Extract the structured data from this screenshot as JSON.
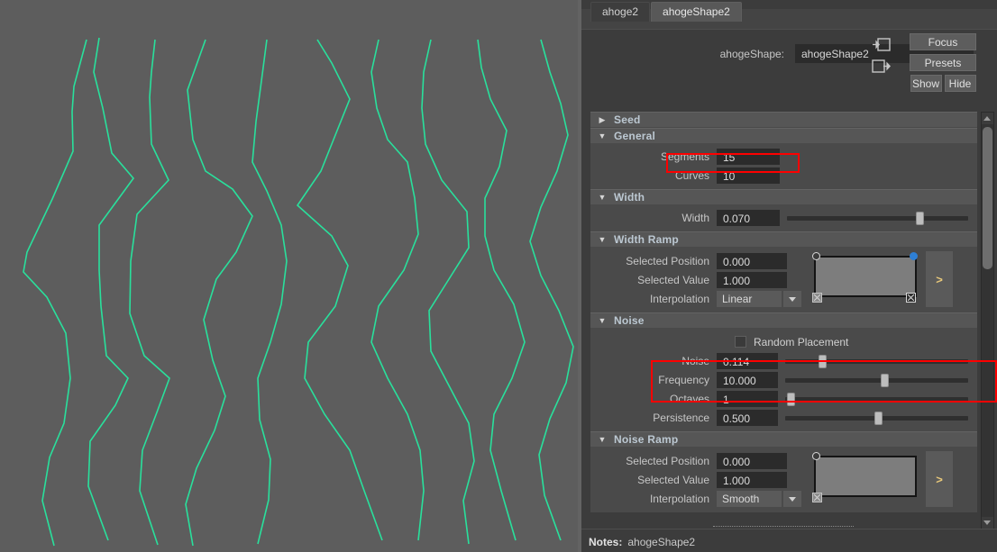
{
  "app": {
    "viewport_bg": "#5d5d5d",
    "curve_color": "#29e09c",
    "panel_bg": "#3c3c3c",
    "highlight_color": "#fe0000"
  },
  "tabs": [
    {
      "label": "ahoge2",
      "active": false
    },
    {
      "label": "ahogeShape2",
      "active": true
    }
  ],
  "name_row": {
    "label": "ahogeShape:",
    "value": "ahogeShape2",
    "placeholder": "ahogeShape2",
    "icon_load": "load-attributes-icon",
    "icon_copy": "copy-attributes-icon"
  },
  "side_buttons": {
    "focus": "Focus",
    "presets": "Presets",
    "show": "Show",
    "hide": "Hide"
  },
  "sections": {
    "seed": {
      "title": "Seed",
      "expanded": false,
      "arrow": "collapsed-arrow-icon"
    },
    "general": {
      "title": "General",
      "expanded": true,
      "segments": {
        "label": "Segments",
        "value": "15"
      },
      "curves": {
        "label": "Curves",
        "value": "10"
      }
    },
    "width": {
      "title": "Width",
      "expanded": true,
      "width": {
        "label": "Width",
        "value": "0.070",
        "slider_pct": 72
      }
    },
    "width_ramp": {
      "title": "Width Ramp",
      "expanded": true,
      "selected_position": {
        "label": "Selected Position",
        "value": "0.000"
      },
      "selected_value": {
        "label": "Selected Value",
        "value": "1.000"
      },
      "interpolation": {
        "label": "Interpolation",
        "value": "Linear"
      },
      "expand_arrow": ">"
    },
    "noise": {
      "title": "Noise",
      "expanded": true,
      "random_placement": {
        "label": "Random Placement",
        "checked": false
      },
      "noise": {
        "label": "Noise",
        "value": "0.114",
        "slider_pct": 19
      },
      "frequency": {
        "label": "Frequency",
        "value": "10.000",
        "slider_pct": 53
      },
      "octaves": {
        "label": "Octaves",
        "value": "1",
        "slider_pct": 2
      },
      "persistence": {
        "label": "Persistence",
        "value": "0.500",
        "slider_pct": 50
      }
    },
    "noise_ramp": {
      "title": "Noise Ramp",
      "expanded": true,
      "selected_position": {
        "label": "Selected Position",
        "value": "0.000"
      },
      "selected_value": {
        "label": "Selected Value",
        "value": "1.000"
      },
      "interpolation": {
        "label": "Interpolation",
        "value": "Smooth"
      },
      "expand_arrow": ">"
    }
  },
  "footer": {
    "notes_label": "Notes:",
    "notes_value": "ahogeShape2"
  },
  "viewport_curves": {
    "count": 10,
    "description": "green zigzag noise curves"
  }
}
